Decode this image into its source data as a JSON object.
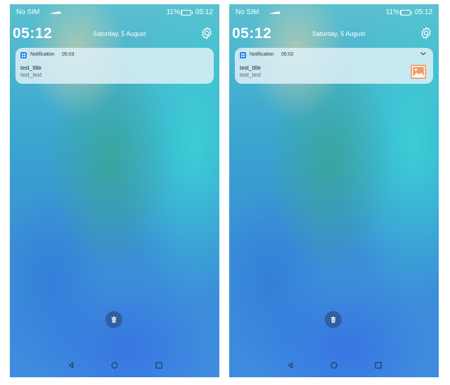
{
  "screens": [
    {
      "status": {
        "carrier": "No SIM",
        "battery": "11%",
        "clock": "05:12"
      },
      "lock_time": "05:12",
      "date": "Saturday, 5 August",
      "notification": {
        "app_name": "Notification",
        "time": "05:03",
        "title": "test_title",
        "text": "test_text"
      }
    },
    {
      "status": {
        "carrier": "No SIM",
        "battery": "11%",
        "clock": "05:12"
      },
      "lock_time": "05:12",
      "date": "Saturday, 5 August",
      "notification": {
        "app_name": "Notification",
        "time": "05:02",
        "title": "test_title",
        "text": "test_text"
      }
    }
  ],
  "colors": {
    "app_icon": "#2e7de0",
    "thumbnail": "#f39a67"
  },
  "icons": [
    "signal-icon",
    "battery-icon",
    "settings-gear-icon",
    "app-icon",
    "chevron-down-icon",
    "image-thumbnail-icon",
    "trash-icon",
    "back-icon",
    "home-icon",
    "recents-icon"
  ]
}
